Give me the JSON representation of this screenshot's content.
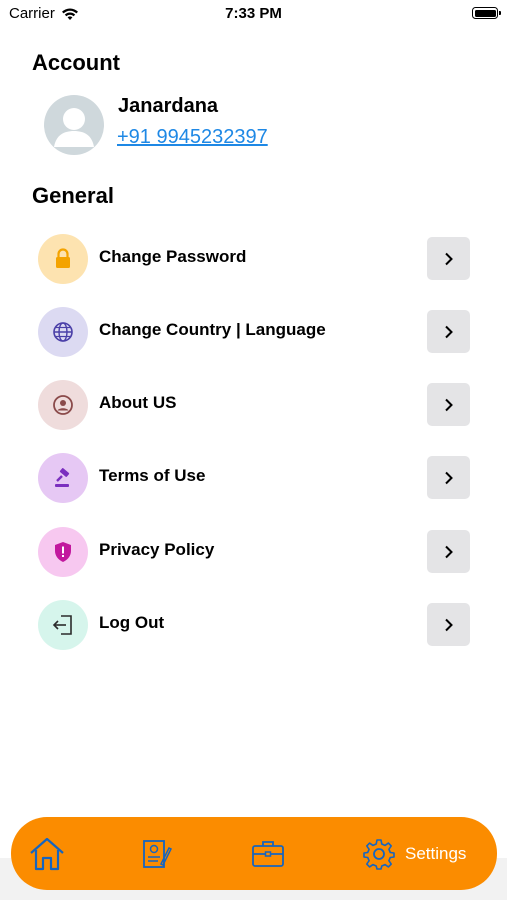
{
  "status_bar": {
    "carrier": "Carrier",
    "time": "7:33 PM"
  },
  "account": {
    "title": "Account",
    "name": "Janardana",
    "phone": "+91  9945232397"
  },
  "general": {
    "title": "General",
    "items": [
      {
        "label": "Change Password",
        "icon": "lock-icon",
        "icon_bg": "#fde3b0",
        "icon_color": "#f4a300"
      },
      {
        "label": "Change Country | Language",
        "icon": "globe-icon",
        "icon_bg": "#dcdaf2",
        "icon_color": "#4a3fa8"
      },
      {
        "label": "About US",
        "icon": "user-circle-icon",
        "icon_bg": "#efdcdc",
        "icon_color": "#8a4a4a"
      },
      {
        "label": "Terms of Use",
        "icon": "gavel-icon",
        "icon_bg": "#e6c8f4",
        "icon_color": "#7b2fbf"
      },
      {
        "label": "Privacy Policy",
        "icon": "shield-icon",
        "icon_bg": "#f7c8f0",
        "icon_color": "#c2189e"
      },
      {
        "label": "Log Out",
        "icon": "logout-icon",
        "icon_bg": "#d6f5ec",
        "icon_color": "#2b2b2b"
      }
    ]
  },
  "tab_bar": {
    "background": "#fb8c00",
    "tabs": [
      {
        "icon": "home-icon"
      },
      {
        "icon": "document-icon"
      },
      {
        "icon": "briefcase-icon"
      },
      {
        "icon": "gear-icon",
        "label": "Settings",
        "active": true
      }
    ]
  }
}
